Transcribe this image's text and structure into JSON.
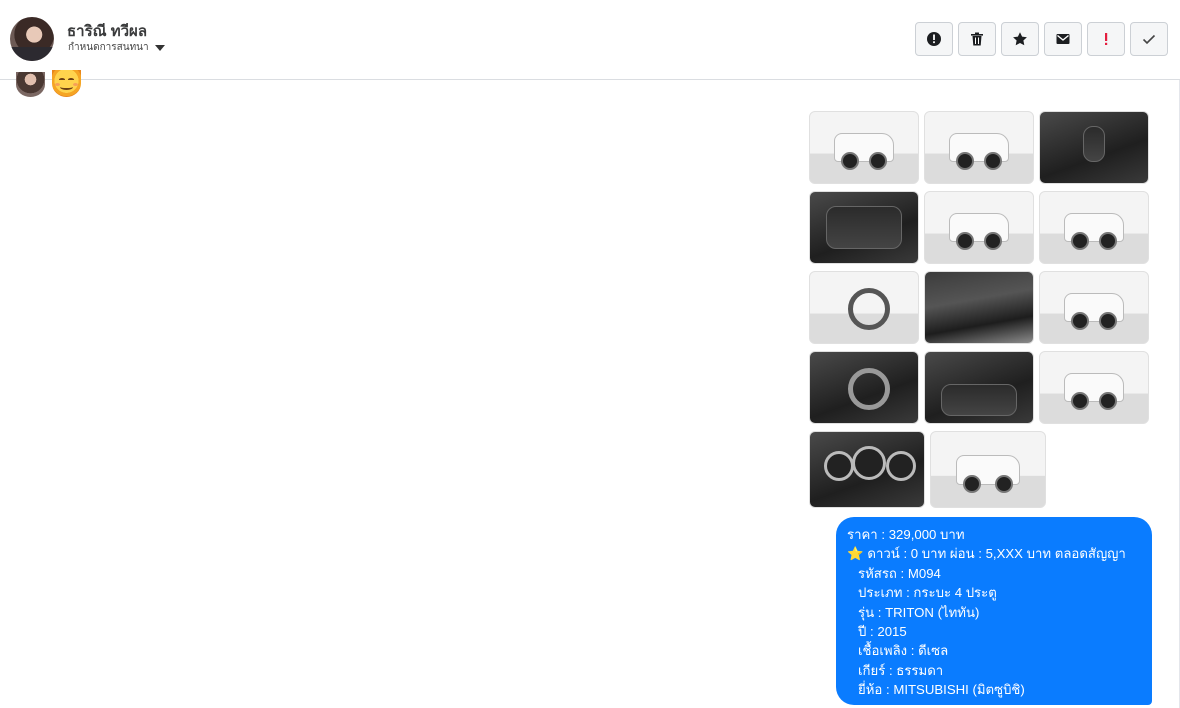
{
  "header": {
    "contact_name": "ธาริณี ทวีผล",
    "conversation_settings": "กำหนดการสนทนา",
    "actions": [
      {
        "name": "report-spam",
        "icon": "alert-circle-icon"
      },
      {
        "name": "delete",
        "icon": "trash-icon"
      },
      {
        "name": "star",
        "icon": "star-icon"
      },
      {
        "name": "mark-unread",
        "icon": "envelope-icon"
      },
      {
        "name": "important",
        "icon": "exclamation-icon"
      },
      {
        "name": "mark-done",
        "icon": "checkmark-icon"
      }
    ]
  },
  "messages": {
    "photo_album": {
      "rows": [
        [
          "car-front-left",
          "car-rear",
          "gear-shifter"
        ],
        [
          "rear-seats",
          "car-front",
          "car-front-left-2"
        ],
        [
          "car-side-wheel",
          "engine-bay",
          "car-side"
        ],
        [
          "dashboard",
          "dashboard-center",
          "car-front-3"
        ],
        [
          "instrument-cluster",
          "car-rear-2"
        ]
      ]
    },
    "info": {
      "price": "ราคา : 329,000 บาท",
      "down": "ดาวน์ : 0 บาท ผ่อน : 5,XXX   บาท ตลอดสัญญา",
      "star_icon": "⭐",
      "code": "รหัสรถ : M094",
      "type": "ประเภท : กระบะ 4 ประตู",
      "model": "รุ่น : TRITON (ไททัน)",
      "year": "ปี : 2015",
      "fuel": "เชื้อเพลิง : ดีเซล",
      "gear": "เกียร์ : ธรรมดา",
      "brand": "ยี่ห้อ : MITSUBISHI (มิตซูบิชิ)"
    }
  },
  "colors": {
    "bubble": "#0a7cff",
    "header_border": "#dadde1",
    "important_icon": "#e41e3f"
  }
}
